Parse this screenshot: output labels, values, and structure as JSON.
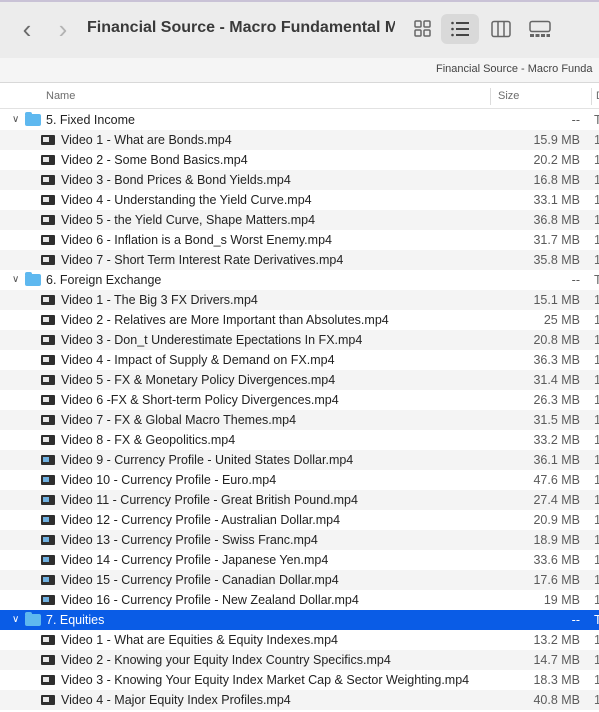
{
  "window": {
    "title": "Financial Source - Macro Fundamental M...",
    "path_text": "Financial Source - Macro Funda"
  },
  "toolbar": {
    "back_icon": "chevron-left-icon",
    "forward_icon": "chevron-right-icon",
    "views": [
      "icon-view",
      "list-view",
      "column-view",
      "gallery-view"
    ],
    "active_view": "list-view"
  },
  "columns": {
    "name": "Name",
    "size": "Size",
    "date": "D"
  },
  "colors": {
    "selection": "#0a5ce6",
    "folder": "#5eb8ef"
  },
  "rows": [
    {
      "type": "folder",
      "name": "5. Fixed Income",
      "size": "--",
      "kind": "T"
    },
    {
      "type": "file",
      "name": "Video 1 - What are Bonds.mp4",
      "size": "15.9 MB",
      "kind": "1"
    },
    {
      "type": "file",
      "name": "Video 2 - Some Bond Basics.mp4",
      "size": "20.2 MB",
      "kind": "1"
    },
    {
      "type": "file",
      "name": "Video 3 - Bond Prices & Bond Yields.mp4",
      "size": "16.8 MB",
      "kind": "1"
    },
    {
      "type": "file",
      "name": "Video 4 - Understanding the Yield Curve.mp4",
      "size": "33.1 MB",
      "kind": "1"
    },
    {
      "type": "file",
      "name": "Video 5 - the Yield Curve, Shape Matters.mp4",
      "size": "36.8 MB",
      "kind": "1"
    },
    {
      "type": "file",
      "name": "Video 6 - Inflation is a Bond_s Worst Enemy.mp4",
      "size": "31.7 MB",
      "kind": "1"
    },
    {
      "type": "file",
      "name": "Video 7 - Short Term Interest Rate Derivatives.mp4",
      "size": "35.8 MB",
      "kind": "1"
    },
    {
      "type": "folder",
      "name": "6. Foreign Exchange",
      "size": "--",
      "kind": "T"
    },
    {
      "type": "file",
      "name": "Video 1 - The Big 3 FX Drivers.mp4",
      "size": "15.1 MB",
      "kind": "1"
    },
    {
      "type": "file",
      "name": "Video 2 - Relatives are More Important than Absolutes.mp4",
      "size": "25 MB",
      "kind": "1"
    },
    {
      "type": "file",
      "name": "Video 3 - Don_t Underestimate Epectations In FX.mp4",
      "size": "20.8 MB",
      "kind": "1"
    },
    {
      "type": "file",
      "name": "Video 4 - Impact of Supply & Demand on FX.mp4",
      "size": "36.3 MB",
      "kind": "1"
    },
    {
      "type": "file",
      "name": "Video 5 - FX & Monetary Policy Divergences.mp4",
      "size": "31.4 MB",
      "kind": "1"
    },
    {
      "type": "file",
      "name": "Video 6 -FX & Short-term Policy Divergences.mp4",
      "size": "26.3 MB",
      "kind": "1"
    },
    {
      "type": "file",
      "name": "Video 7 - FX & Global Macro Themes.mp4",
      "size": "31.5 MB",
      "kind": "1"
    },
    {
      "type": "file",
      "name": "Video 8 - FX & Geopolitics.mp4",
      "size": "33.2 MB",
      "kind": "1"
    },
    {
      "type": "file",
      "name": "Video 9 - Currency Profile - United States Dollar.mp4",
      "size": "36.1 MB",
      "kind": "1",
      "blue": true
    },
    {
      "type": "file",
      "name": "Video 10 - Currency Profile - Euro.mp4",
      "size": "47.6 MB",
      "kind": "1",
      "blue": true
    },
    {
      "type": "file",
      "name": "Video 11 - Currency Profile - Great British Pound.mp4",
      "size": "27.4 MB",
      "kind": "1",
      "blue": true
    },
    {
      "type": "file",
      "name": "Video 12 - Currency Profile - Australian Dollar.mp4",
      "size": "20.9 MB",
      "kind": "1",
      "blue": true
    },
    {
      "type": "file",
      "name": "Video 13 - Currency Profile - Swiss Franc.mp4",
      "size": "18.9 MB",
      "kind": "1",
      "blue": true
    },
    {
      "type": "file",
      "name": "Video 14 - Currency Profile - Japanese Yen.mp4",
      "size": "33.6 MB",
      "kind": "1",
      "blue": true
    },
    {
      "type": "file",
      "name": "Video 15 - Currency Profile - Canadian Dollar.mp4",
      "size": "17.6 MB",
      "kind": "1",
      "blue": true
    },
    {
      "type": "file",
      "name": "Video 16 - Currency Profile - New Zealand Dollar.mp4",
      "size": "19 MB",
      "kind": "1",
      "blue": true
    },
    {
      "type": "folder",
      "name": "7. Equities",
      "size": "--",
      "kind": "T",
      "selected": true
    },
    {
      "type": "file",
      "name": "Video 1 - What are Equities & Equity Indexes.mp4",
      "size": "13.2 MB",
      "kind": "1"
    },
    {
      "type": "file",
      "name": "Video 2 - Knowing your Equity Index Country Specifics.mp4",
      "size": "14.7 MB",
      "kind": "1"
    },
    {
      "type": "file",
      "name": "Video 3 - Knowing Your Equity Index Market Cap & Sector Weighting.mp4",
      "size": "18.3 MB",
      "kind": "1"
    },
    {
      "type": "file",
      "name": "Video 4 - Major Equity Index Profiles.mp4",
      "size": "40.8 MB",
      "kind": "1"
    }
  ]
}
